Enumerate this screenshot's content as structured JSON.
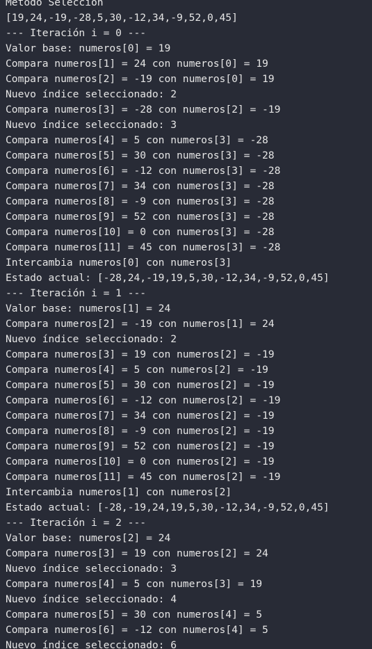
{
  "terminal": {
    "lines": [
      "Metodo Seleccion",
      "[19,24,-19,-28,5,30,-12,34,-9,52,0,45]",
      "--- Iteración i = 0 ---",
      "Valor base: numeros[0] = 19",
      "Compara numeros[1] = 24 con numeros[0] = 19",
      "Compara numeros[2] = -19 con numeros[0] = 19",
      "Nuevo índice seleccionado: 2",
      "Compara numeros[3] = -28 con numeros[2] = -19",
      "Nuevo índice seleccionado: 3",
      "Compara numeros[4] = 5 con numeros[3] = -28",
      "Compara numeros[5] = 30 con numeros[3] = -28",
      "Compara numeros[6] = -12 con numeros[3] = -28",
      "Compara numeros[7] = 34 con numeros[3] = -28",
      "Compara numeros[8] = -9 con numeros[3] = -28",
      "Compara numeros[9] = 52 con numeros[3] = -28",
      "Compara numeros[10] = 0 con numeros[3] = -28",
      "Compara numeros[11] = 45 con numeros[3] = -28",
      "Intercambia numeros[0] con numeros[3]",
      "Estado actual: [-28,24,-19,19,5,30,-12,34,-9,52,0,45]",
      "--- Iteración i = 1 ---",
      "Valor base: numeros[1] = 24",
      "Compara numeros[2] = -19 con numeros[1] = 24",
      "Nuevo índice seleccionado: 2",
      "Compara numeros[3] = 19 con numeros[2] = -19",
      "Compara numeros[4] = 5 con numeros[2] = -19",
      "Compara numeros[5] = 30 con numeros[2] = -19",
      "Compara numeros[6] = -12 con numeros[2] = -19",
      "Compara numeros[7] = 34 con numeros[2] = -19",
      "Compara numeros[8] = -9 con numeros[2] = -19",
      "Compara numeros[9] = 52 con numeros[2] = -19",
      "Compara numeros[10] = 0 con numeros[2] = -19",
      "Compara numeros[11] = 45 con numeros[2] = -19",
      "Intercambia numeros[1] con numeros[2]",
      "Estado actual: [-28,-19,24,19,5,30,-12,34,-9,52,0,45]",
      "--- Iteración i = 2 ---",
      "Valor base: numeros[2] = 24",
      "Compara numeros[3] = 19 con numeros[2] = 24",
      "Nuevo índice seleccionado: 3",
      "Compara numeros[4] = 5 con numeros[3] = 19",
      "Nuevo índice seleccionado: 4",
      "Compara numeros[5] = 30 con numeros[4] = 5",
      "Compara numeros[6] = -12 con numeros[4] = 5",
      "Nuevo índice seleccionado: 6"
    ]
  }
}
